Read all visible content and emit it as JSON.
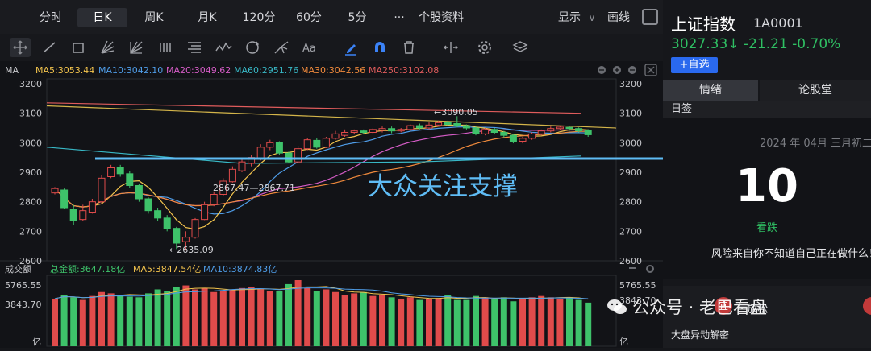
{
  "tabs": [
    "分时",
    "日K",
    "周K",
    "月K",
    "120分",
    "60分",
    "5分",
    "···",
    "个股资料"
  ],
  "active_tab": "日K",
  "display_label": "显示",
  "chevron": "∨",
  "draw_label": "画线",
  "ma_legend": {
    "ma": "MA",
    "ma5": "MA5:3053.44",
    "ma10": "MA10:3042.10",
    "ma20": "MA20:3049.62",
    "ma60": "MA60:2951.76",
    "ma30": "MA30:3042.56",
    "ma250": "MA250:3102.08"
  },
  "vol_legend": {
    "title": "成交额",
    "total": "总金额:3647.18亿",
    "ma5": "MA5:3847.54亿",
    "ma10": "MA10:3874.83亿"
  },
  "price_axis": [
    "3200",
    "3100",
    "3000",
    "2900",
    "2800",
    "2700",
    "2600"
  ],
  "vol_axis": [
    "5765.55",
    "3843.70",
    "亿"
  ],
  "annotations": {
    "high": "←3090.05",
    "mid": "2867.47—2867.71",
    "low": "←2635.09",
    "support": "大众关注支撑"
  },
  "colors": {
    "up": "#e04b4b",
    "down": "#3ec26a",
    "ma5": "#f3c44d",
    "ma10": "#4f9de8",
    "ma20": "#d55cc6",
    "ma60": "#38b8c6",
    "ma30": "#f08a3c",
    "ma250": "#e05c5c",
    "support": "#5fbcf5"
  },
  "index": {
    "name": "上证指数",
    "code": "1A0001",
    "price_line": "3027.33↓ -21.21 -0.70%",
    "add_label": "+自选"
  },
  "right_tabs": [
    "情绪",
    "论股堂"
  ],
  "sub_label": "日签",
  "calendar": {
    "date": "2024 年 04月  三月初二",
    "day": "10",
    "status": "看跌",
    "quote": "风险来自你不知道自己正在做什么！"
  },
  "card": {
    "yi": "宜",
    "relax": "· 放松",
    "title": "大盘异动解密"
  },
  "watermark": "公众号 · 老巴看盘",
  "chart_data": {
    "type": "candlestick",
    "price_range": [
      2600,
      3200
    ],
    "candles": [
      [
        2830,
        2845,
        2825,
        2850
      ],
      [
        2840,
        2780,
        2775,
        2845
      ],
      [
        2775,
        2735,
        2720,
        2790
      ],
      [
        2740,
        2770,
        2735,
        2790
      ],
      [
        2765,
        2800,
        2760,
        2810
      ],
      [
        2800,
        2880,
        2795,
        2890
      ],
      [
        2885,
        2915,
        2880,
        2925
      ],
      [
        2915,
        2895,
        2885,
        2925
      ],
      [
        2895,
        2855,
        2848,
        2905
      ],
      [
        2855,
        2810,
        2800,
        2860
      ],
      [
        2810,
        2770,
        2760,
        2815
      ],
      [
        2770,
        2745,
        2735,
        2780
      ],
      [
        2745,
        2710,
        2700,
        2755
      ],
      [
        2710,
        2660,
        2640,
        2715
      ],
      [
        2665,
        2680,
        2635,
        2700
      ],
      [
        2680,
        2740,
        2675,
        2745
      ],
      [
        2740,
        2790,
        2738,
        2800
      ],
      [
        2790,
        2825,
        2785,
        2835
      ],
      [
        2825,
        2870,
        2820,
        2880
      ],
      [
        2868,
        2910,
        2865,
        2920
      ],
      [
        2905,
        2935,
        2900,
        2945
      ],
      [
        2930,
        2950,
        2920,
        2960
      ],
      [
        2945,
        2985,
        2940,
        2995
      ],
      [
        2985,
        3000,
        2975,
        3010
      ],
      [
        3000,
        2965,
        2960,
        3005
      ],
      [
        2965,
        2935,
        2930,
        2970
      ],
      [
        2935,
        2980,
        2930,
        2990
      ],
      [
        2980,
        3010,
        2975,
        3015
      ],
      [
        3008,
        2985,
        2980,
        3015
      ],
      [
        2985,
        3015,
        2982,
        3020
      ],
      [
        3015,
        3030,
        3010,
        3040
      ],
      [
        3025,
        3035,
        3020,
        3045
      ],
      [
        3035,
        3040,
        3028,
        3045
      ],
      [
        3040,
        3035,
        3028,
        3045
      ],
      [
        3035,
        3045,
        3030,
        3050
      ],
      [
        3042,
        3048,
        3035,
        3055
      ],
      [
        3048,
        3040,
        3032,
        3055
      ],
      [
        3040,
        3045,
        3035,
        3050
      ],
      [
        3045,
        3058,
        3040,
        3062
      ],
      [
        3058,
        3050,
        3045,
        3065
      ],
      [
        3050,
        3060,
        3045,
        3070
      ],
      [
        3060,
        3068,
        3055,
        3075
      ],
      [
        3068,
        3062,
        3058,
        3075
      ],
      [
        3065,
        3058,
        3052,
        3090
      ],
      [
        3058,
        3050,
        3045,
        3062
      ],
      [
        3050,
        3030,
        3025,
        3055
      ],
      [
        3030,
        3045,
        3025,
        3050
      ],
      [
        3045,
        3035,
        3030,
        3050
      ],
      [
        3035,
        3025,
        3018,
        3040
      ],
      [
        3025,
        3005,
        2998,
        3030
      ],
      [
        3005,
        3015,
        2998,
        3020
      ],
      [
        3015,
        3030,
        3010,
        3035
      ],
      [
        3030,
        3040,
        3025,
        3045
      ],
      [
        3040,
        3048,
        3035,
        3055
      ],
      [
        3048,
        3053,
        3042,
        3058
      ],
      [
        3052,
        3048,
        3040,
        3058
      ],
      [
        3048,
        3040,
        3035,
        3052
      ],
      [
        3042,
        3027,
        3020,
        3046
      ]
    ],
    "volumes": [
      0.72,
      0.78,
      0.74,
      0.7,
      0.76,
      0.82,
      0.8,
      0.78,
      0.75,
      0.74,
      0.8,
      0.86,
      0.84,
      0.9,
      0.92,
      0.86,
      0.88,
      0.82,
      0.84,
      0.86,
      0.88,
      0.9,
      0.86,
      0.84,
      0.83,
      0.94,
      1.0,
      0.88,
      0.84,
      0.86,
      0.82,
      0.78,
      0.8,
      0.82,
      0.76,
      0.78,
      0.74,
      0.72,
      0.74,
      0.7,
      0.72,
      0.73,
      0.78,
      0.7,
      0.7,
      0.76,
      0.74,
      0.72,
      0.74,
      0.68,
      0.72,
      0.74,
      0.76,
      0.74,
      0.72,
      0.74,
      0.7,
      0.66
    ]
  }
}
